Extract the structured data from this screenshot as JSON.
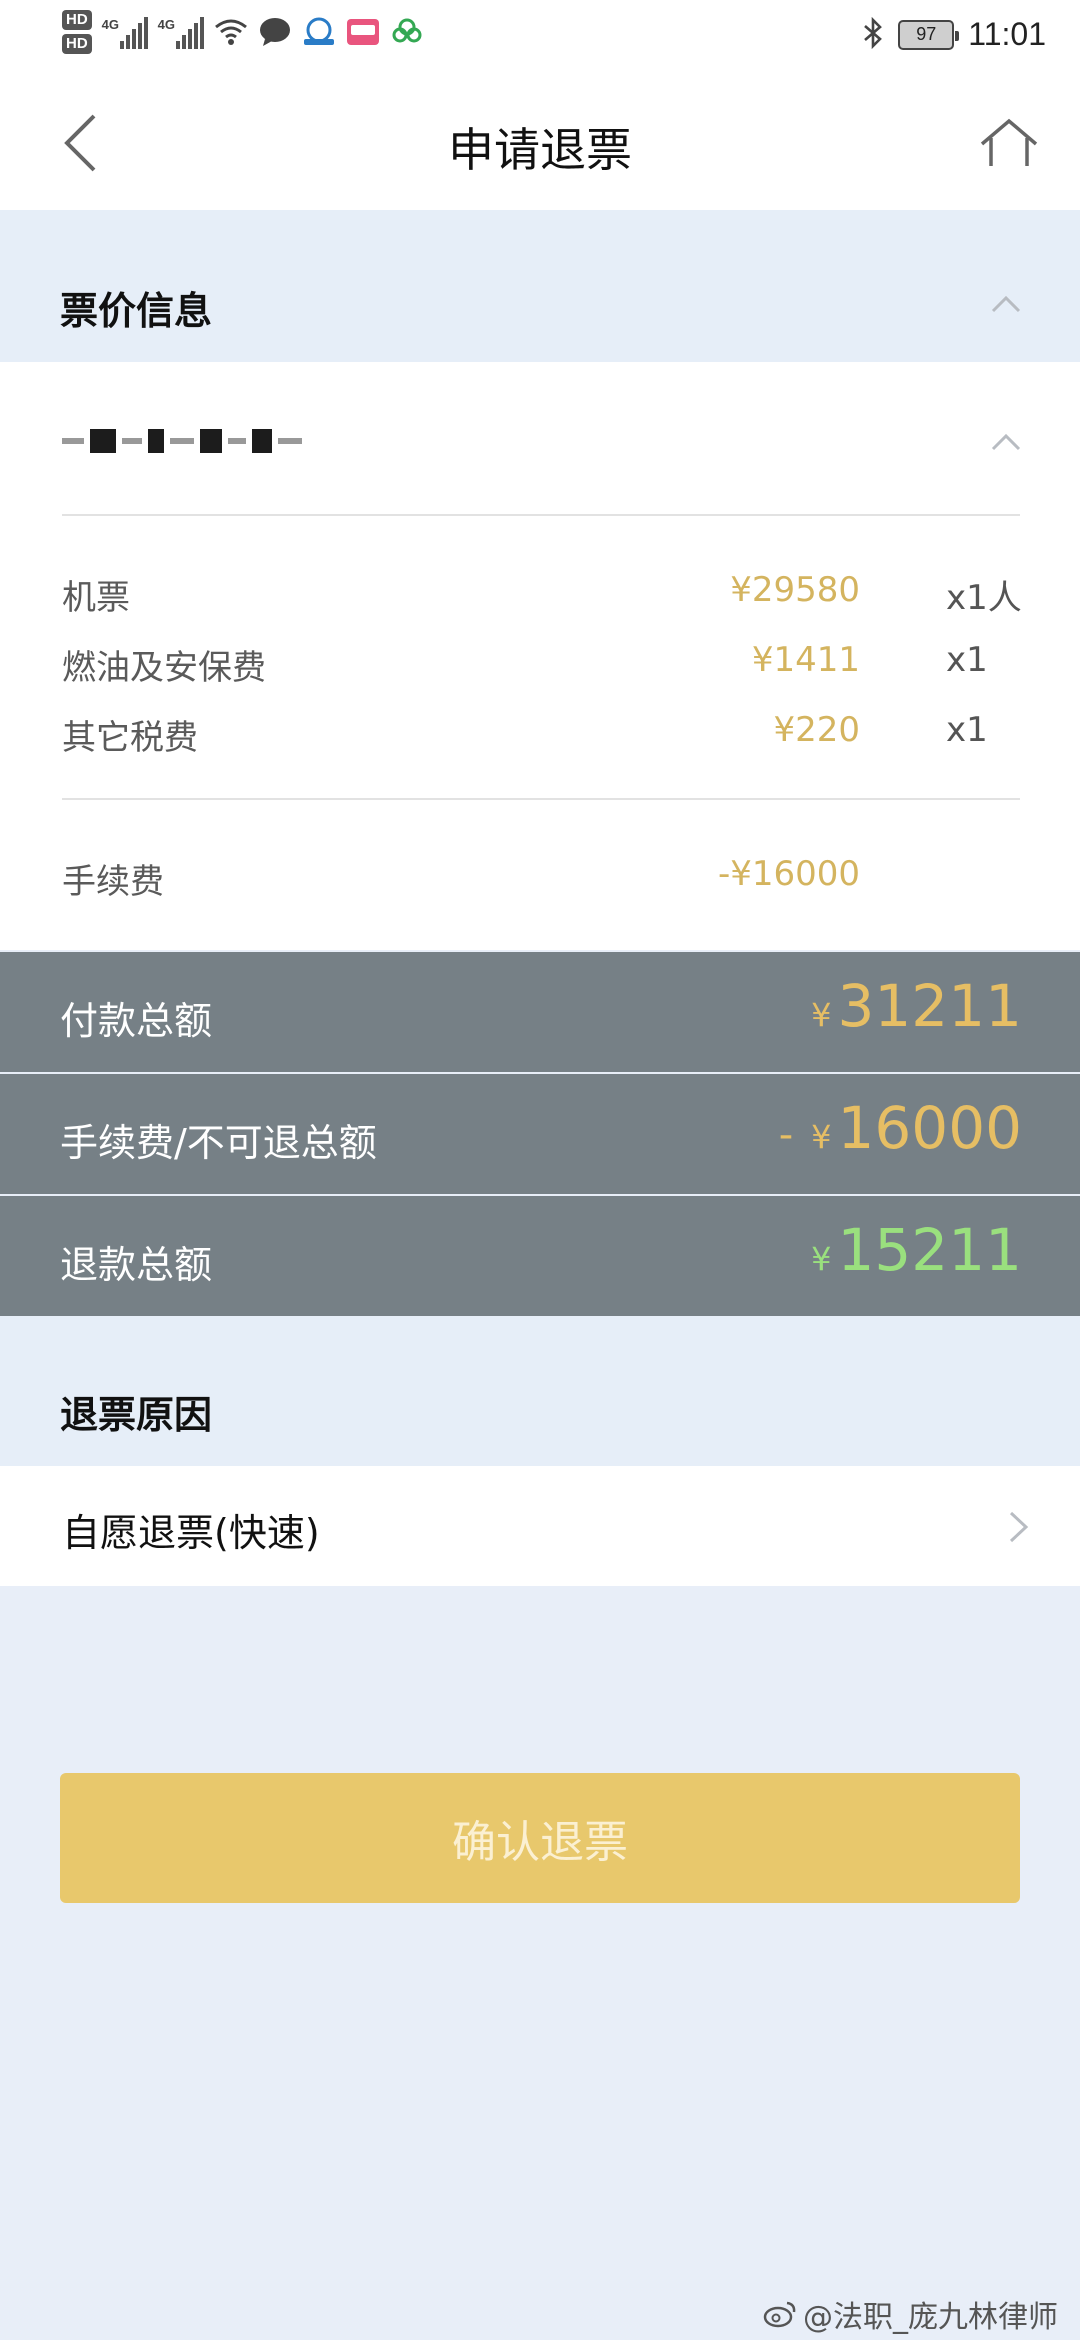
{
  "status_bar": {
    "hd_1": "HD",
    "hd_2": "HD",
    "sim1_label": "4G",
    "sim2_label": "4G",
    "battery": "97",
    "time": "11:01"
  },
  "header": {
    "title": "申请退票",
    "back_icon": "chevron-left-icon",
    "home_icon": "home-icon"
  },
  "ticket_section": {
    "title": "票价信息"
  },
  "fare_items": [
    {
      "name": "机票",
      "amount": "¥29580",
      "qty": "x1人"
    },
    {
      "name": "燃油及安保费",
      "amount": "¥1411",
      "qty": "x1"
    },
    {
      "name": "其它税费",
      "amount": "¥220",
      "qty": "x1"
    }
  ],
  "fee_item": {
    "name": "手续费",
    "amount": "-¥16000"
  },
  "summary": {
    "paid_label": "付款总额",
    "paid_currency": "¥",
    "paid_value": "31211",
    "fee_label": "手续费/不可退总额",
    "fee_prefix": "-",
    "fee_currency": "¥",
    "fee_value": "16000",
    "refund_label": "退款总额",
    "refund_currency": "¥",
    "refund_value": "15211"
  },
  "reason_section": {
    "title": "退票原因",
    "value": "自愿退票(快速)"
  },
  "confirm_button": "确认退票",
  "watermark": "@法职_庞九林律师",
  "colors": {
    "accent_gold": "#e8c86c",
    "amount_gold": "#d4b45f",
    "refund_green": "#9ae07e",
    "summary_bg": "#768086"
  }
}
